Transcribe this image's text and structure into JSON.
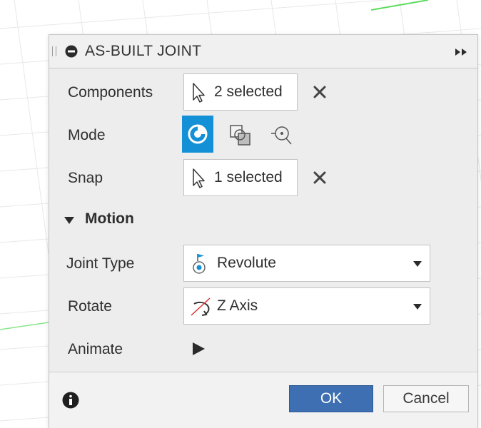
{
  "dialog": {
    "title": "AS-BUILT JOINT",
    "components": {
      "label": "Components",
      "value": "2 selected"
    },
    "mode": {
      "label": "Mode",
      "options": [
        "mode-icon-1",
        "mode-icon-2",
        "mode-icon-3"
      ],
      "selected_index": 0
    },
    "snap": {
      "label": "Snap",
      "value": "1 selected"
    },
    "motion": {
      "title": "Motion",
      "joint_type": {
        "label": "Joint Type",
        "value": "Revolute"
      },
      "rotate": {
        "label": "Rotate",
        "value": "Z Axis"
      },
      "animate": {
        "label": "Animate"
      }
    },
    "footer": {
      "ok_label": "OK",
      "cancel_label": "Cancel"
    }
  },
  "colors": {
    "accent_blue": "#1490d6",
    "ok_button": "#3d6fb2",
    "grid_green": "#5fdc5f",
    "axis_red": "#e03030"
  },
  "icons": {
    "title": "stop-circle-icon",
    "collapse": "double-chevron-right-icon",
    "selection": "cursor-arrow-icon",
    "clear": "close-x-icon",
    "joint": "revolute-joint-icon",
    "axis": "rotate-axis-icon",
    "info": "info-icon",
    "play": "play-icon"
  }
}
